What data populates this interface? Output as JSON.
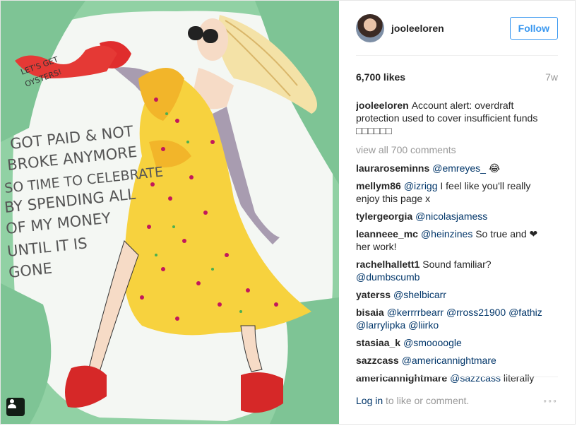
{
  "post": {
    "username": "jooleeloren",
    "follow_label": "Follow",
    "likes": "6,700 likes",
    "age": "7w",
    "caption": {
      "user": "jooleeloren",
      "text": "Account alert: overdraft protection used to cover insufficient funds □□□□□□"
    },
    "view_all": "view all 700 comments",
    "comments": [
      {
        "user": "lauraroseminns",
        "parts": [
          {
            "mention": "@emreyes_"
          },
          {
            "text": " 😂"
          }
        ]
      },
      {
        "user": "mellym86",
        "parts": [
          {
            "mention": "@izrigg"
          },
          {
            "text": " I feel like you'll really enjoy this page x"
          }
        ]
      },
      {
        "user": "tylergeorgia",
        "parts": [
          {
            "mention": "@nicolasjamess"
          }
        ]
      },
      {
        "user": "leanneee_mc",
        "parts": [
          {
            "mention": "@heinzines"
          },
          {
            "text": " So true and ❤ her work!"
          }
        ]
      },
      {
        "user": "rachelhallett1",
        "parts": [
          {
            "text": "Sound familiar? "
          },
          {
            "mention": "@dumbscumb"
          }
        ]
      },
      {
        "user": "yaterss",
        "parts": [
          {
            "mention": "@shelbicarr"
          }
        ]
      },
      {
        "user": "bisaia",
        "parts": [
          {
            "mention": "@kerrrrbearr"
          },
          {
            "text": " "
          },
          {
            "mention": "@rross21900"
          },
          {
            "text": " "
          },
          {
            "mention": "@fathiz"
          },
          {
            "text": " "
          },
          {
            "mention": "@larrylipka"
          },
          {
            "text": " "
          },
          {
            "mention": "@liirko"
          }
        ]
      },
      {
        "user": "stasiaa_k",
        "parts": [
          {
            "mention": "@smoooogle"
          }
        ]
      },
      {
        "user": "sazzcass",
        "parts": [
          {
            "mention": "@americannightmare"
          }
        ]
      },
      {
        "user": "americannightmare",
        "parts": [
          {
            "mention": "@sazzcass"
          },
          {
            "text": " literally"
          }
        ]
      }
    ],
    "footer": {
      "login_link": "Log in",
      "login_text": " to like or comment.",
      "more": "◦◦◦"
    }
  },
  "artwork": {
    "speech_text": [
      "LET'S GET",
      "OYSTERS!"
    ],
    "handwritten_lines": [
      "GOT PAID & NOT",
      "BROKE ANYMORE",
      "SO TIME TO CELEBRATE",
      "BY SPENDING ALL",
      "OF MY MONEY",
      "UNTIL IT IS",
      "GONE"
    ]
  },
  "colors": {
    "accent": "#3897f0",
    "mention": "#003569",
    "muted": "#999999",
    "background_green": "#8fd0a2",
    "dress_yellow": "#f7d23e"
  },
  "icons": {
    "user_tag": "person-icon",
    "scroll_up": "arrow-up-icon",
    "scroll_down": "arrow-down-icon"
  }
}
